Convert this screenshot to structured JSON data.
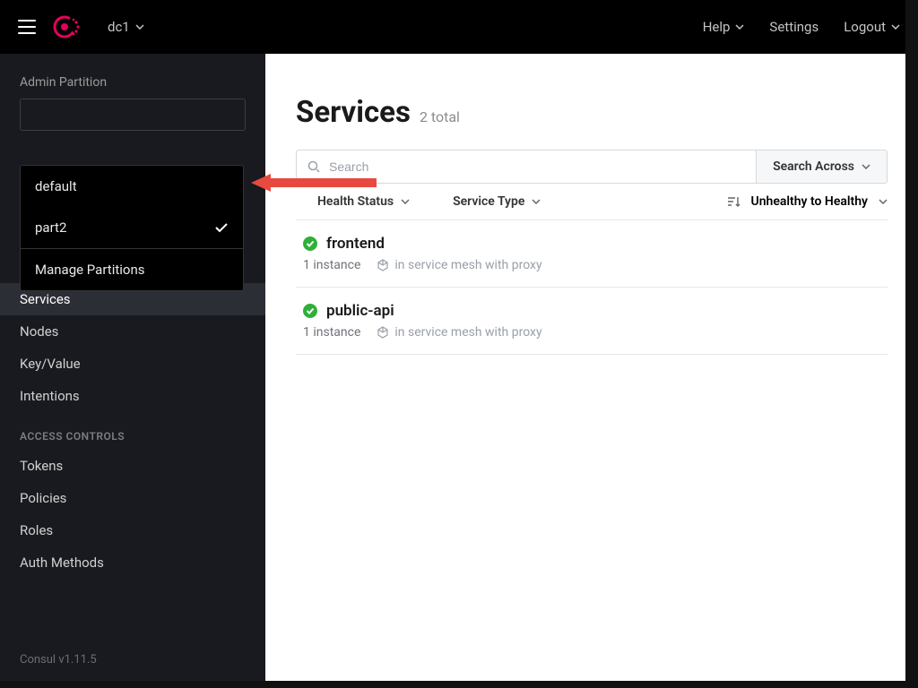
{
  "topbar": {
    "datacenter": "dc1",
    "help": "Help",
    "settings": "Settings",
    "logout": "Logout"
  },
  "sidebar": {
    "partition_label": "Admin Partition",
    "partition_options": [
      "default",
      "part2"
    ],
    "partition_selected_index": 1,
    "manage_partitions": "Manage Partitions",
    "nav": [
      "Services",
      "Nodes",
      "Key/Value",
      "Intentions"
    ],
    "nav_active_index": 0,
    "access_header": "ACCESS CONTROLS",
    "access_nav": [
      "Tokens",
      "Policies",
      "Roles",
      "Auth Methods"
    ],
    "version": "Consul v1.11.5"
  },
  "main": {
    "title": "Services",
    "count": "2 total",
    "search_placeholder": "Search",
    "search_across": "Search Across",
    "filters": {
      "health": "Health Status",
      "type": "Service Type",
      "sort": "Unhealthy to Healthy"
    },
    "services": [
      {
        "name": "frontend",
        "instances": "1 instance",
        "mesh": "in service mesh with proxy"
      },
      {
        "name": "public-api",
        "instances": "1 instance",
        "mesh": "in service mesh with proxy"
      }
    ]
  }
}
